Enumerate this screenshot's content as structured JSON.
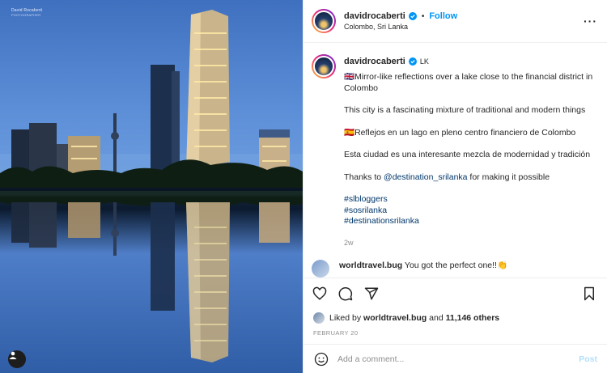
{
  "media": {
    "watermark_line1": "David Rocaberti",
    "watermark_line2": "PHOTOGRAPHER",
    "user_tag_icon": "user-icon"
  },
  "header": {
    "username": "davidrocaberti",
    "verified_icon": "verified-badge-icon",
    "separator": "•",
    "follow_label": "Follow",
    "location": "Colombo, Sri Lanka",
    "more_icon": "more-options-icon",
    "more_label": "···"
  },
  "caption": {
    "username": "davidrocaberti",
    "country": "LK",
    "paragraph1": "🇬🇧Mirror-like reflections over a lake close to the financial district in Colombo",
    "paragraph2": "This city is a fascinating mixture of traditional and modern things",
    "paragraph3": "🇪🇸Reflejos en un lago en pleno centro financiero de Colombo",
    "paragraph4": "Esta ciudad es una interesante mezcla de modernidad y tradición",
    "paragraph5_before": "Thanks to ",
    "paragraph5_mention": "@destination_srilanka",
    "paragraph5_after": " for making it possible",
    "hashtags": [
      "#slbloggers",
      "#sosrilanka",
      "#destinationsrilanka"
    ],
    "age": "2w"
  },
  "comment_peek": {
    "username": "worldtravel.bug",
    "text": "You got the perfect one!!👏"
  },
  "actions": {
    "like_icon": "heart-icon",
    "comment_icon": "comment-icon",
    "share_icon": "share-icon",
    "save_icon": "bookmark-icon"
  },
  "likes": {
    "prefix": "Liked by ",
    "user": "worldtravel.bug",
    "middle": " and ",
    "count": "11,146 others"
  },
  "date": "FEBRUARY 20",
  "comment_box": {
    "emoji_icon": "emoji-icon",
    "placeholder": "Add a comment...",
    "post_label": "Post"
  },
  "colors": {
    "accent": "#0095f6",
    "link": "#00376b",
    "muted": "#8e8e8e",
    "post_disabled": "#b2dffc"
  }
}
